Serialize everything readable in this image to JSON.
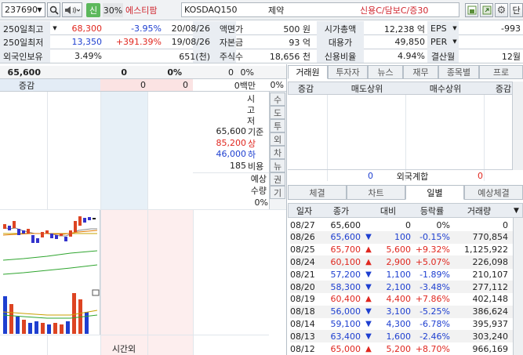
{
  "toolbar": {
    "code": "237690",
    "credit_badge": "신",
    "margin_badge": "30%",
    "name": "에스티팜",
    "market": "KOSDAQ150",
    "sector": "제약",
    "credit_info": "신용C/담보C/증30",
    "unit_button": "단"
  },
  "info": {
    "rows": [
      {
        "label": "250일최고",
        "price": "68,300",
        "pct": "-3.95%",
        "date": "20/08/26",
        "k1": "액면가",
        "v1": "500 원",
        "k2": "시가총액",
        "v2": "12,238 억",
        "k3": "EPS",
        "v3": "-993"
      },
      {
        "label": "250일최저",
        "price": "13,350",
        "pct": "+391.39%",
        "date": "19/08/26",
        "k1": "자본금",
        "v1": "93 억",
        "k2": "대용가",
        "v2": "49,850",
        "k3": "PER",
        "v3": ""
      },
      {
        "label": "외국인보유",
        "price": "3.49%",
        "pct": "",
        "date": "651(천)",
        "k1": "주식수",
        "v1": "18,656 천",
        "k2": "신용비율",
        "v2": "4.94%",
        "k3": "결산월",
        "v3": "12월"
      }
    ]
  },
  "quote": {
    "price": "65,600",
    "change": "0",
    "change_pct": "0%",
    "volume": "0",
    "volume_pct": "0%",
    "delta_label": "증감",
    "ask_total": "0",
    "bid_total": "0",
    "amount": "0백만",
    "amount_pct": "0%",
    "side_labels": [
      "시",
      "고",
      "저"
    ],
    "base_price": "65,600",
    "base_label": "기준",
    "upper_price": "85,200",
    "upper_label": "상",
    "lower_price": "46,000",
    "lower_label": "하",
    "ratio_value": "185",
    "ratio_label": "비용",
    "expected_label": "예상",
    "expected_qty_label": "수량",
    "expected_pct": "0%",
    "side_tabs": [
      "수",
      "도",
      "투",
      "외",
      "차",
      "뉴",
      "권",
      "기"
    ],
    "after_hours": "시간외"
  },
  "broker": {
    "tabs": [
      "거래원",
      "투자자",
      "뉴스",
      "재무",
      "종목별",
      "프로"
    ],
    "headers": [
      "증감",
      "매도상위",
      "매수상위",
      "증감"
    ],
    "foreign_label": "외국계합",
    "foreign_sell": "0",
    "foreign_buy": "0"
  },
  "daily": {
    "tabs": [
      "체결",
      "차트",
      "일별",
      "예상체결"
    ],
    "headers": [
      "일자",
      "종가",
      "대비",
      "등락률",
      "거래량"
    ],
    "rows": [
      {
        "date": "08/27",
        "close": "65,600",
        "dir": "",
        "change": "0",
        "pct": "0%",
        "volume": "0",
        "color": "black"
      },
      {
        "date": "08/26",
        "close": "65,600",
        "dir": "▼",
        "change": "100",
        "pct": "-0.15%",
        "volume": "770,854",
        "color": "blue"
      },
      {
        "date": "08/25",
        "close": "65,700",
        "dir": "▲",
        "change": "5,600",
        "pct": "+9.32%",
        "volume": "1,125,922",
        "color": "red"
      },
      {
        "date": "08/24",
        "close": "60,100",
        "dir": "▲",
        "change": "2,900",
        "pct": "+5.07%",
        "volume": "226,098",
        "color": "red"
      },
      {
        "date": "08/21",
        "close": "57,200",
        "dir": "▼",
        "change": "1,100",
        "pct": "-1.89%",
        "volume": "210,107",
        "color": "blue"
      },
      {
        "date": "08/20",
        "close": "58,300",
        "dir": "▼",
        "change": "2,100",
        "pct": "-3.48%",
        "volume": "277,112",
        "color": "blue"
      },
      {
        "date": "08/19",
        "close": "60,400",
        "dir": "▲",
        "change": "4,400",
        "pct": "+7.86%",
        "volume": "402,148",
        "color": "red"
      },
      {
        "date": "08/18",
        "close": "56,000",
        "dir": "▼",
        "change": "3,100",
        "pct": "-5.25%",
        "volume": "386,624",
        "color": "blue"
      },
      {
        "date": "08/14",
        "close": "59,100",
        "dir": "▼",
        "change": "4,300",
        "pct": "-6.78%",
        "volume": "395,937",
        "color": "blue"
      },
      {
        "date": "08/13",
        "close": "63,400",
        "dir": "▼",
        "change": "1,600",
        "pct": "-2.46%",
        "volume": "303,240",
        "color": "blue"
      },
      {
        "date": "08/12",
        "close": "65,000",
        "dir": "▲",
        "change": "5,200",
        "pct": "+8.70%",
        "volume": "966,169",
        "color": "red"
      }
    ]
  }
}
